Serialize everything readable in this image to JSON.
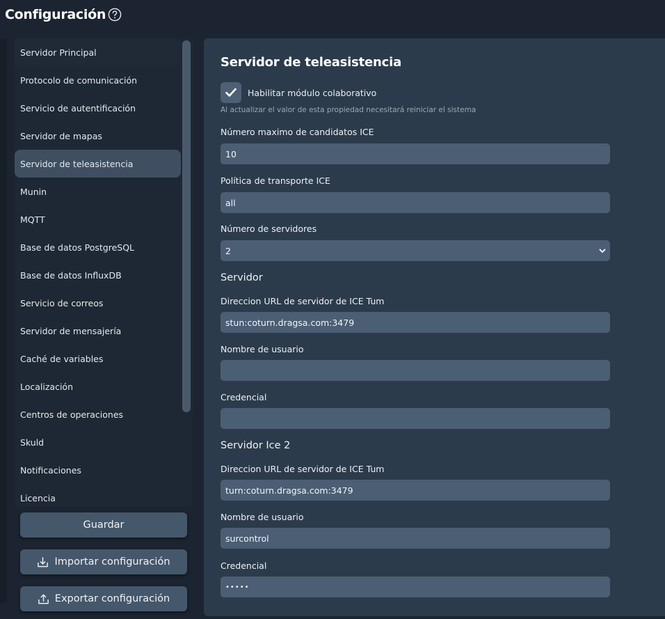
{
  "header": {
    "title": "Configuración"
  },
  "sidebar": {
    "items": [
      {
        "label": "Servidor Principal"
      },
      {
        "label": "Protocolo de comunicación"
      },
      {
        "label": "Servicio de autentificación"
      },
      {
        "label": "Servidor de mapas"
      },
      {
        "label": "Servidor de teleasistencia"
      },
      {
        "label": "Munin"
      },
      {
        "label": "MQTT"
      },
      {
        "label": "Base de datos PostgreSQL"
      },
      {
        "label": "Base de datos InfluxDB"
      },
      {
        "label": "Servicio de correos"
      },
      {
        "label": "Servidor de mensajería"
      },
      {
        "label": "Caché de variables"
      },
      {
        "label": "Localización"
      },
      {
        "label": "Centros de operaciones"
      },
      {
        "label": "Skuld"
      },
      {
        "label": "Notificaciones"
      },
      {
        "label": "Licencia"
      }
    ],
    "active": "Servidor de teleasistencia"
  },
  "actions": {
    "save_label": "Guardar",
    "import_label": "Importar configuración",
    "export_label": "Exportar configuración"
  },
  "panel": {
    "title": "Servidor de teleasistencia",
    "collab": {
      "label": "Habilitar módulo colaborativo",
      "checked": true,
      "hint": "Al actualizar el valor de esta propiedad necesitará reiniciar el sistema"
    },
    "max_ice_candidates": {
      "label": "Número maximo de candidatos ICE",
      "value": "10"
    },
    "ice_transport_policy": {
      "label": "Política de transporte ICE",
      "value": "all"
    },
    "server_count": {
      "label": "Número de servidores",
      "value": "2"
    },
    "servers": [
      {
        "heading": "Servidor",
        "url_label": "Direccion URL de servidor de ICE Tum",
        "url": "stun:coturn.dragsa.com:3479",
        "user_label": "Nombre de usuario",
        "user": "",
        "credential_label": "Credencial",
        "credential": ""
      },
      {
        "heading": "Servidor Ice 2",
        "url_label": "Direccion URL de servidor de ICE Tum",
        "url": "turn:coturn.dragsa.com:3479",
        "user_label": "Nombre de usuario",
        "user": "surcontrol",
        "credential_label": "Credencial",
        "credential": "•••••"
      }
    ]
  },
  "colors": {
    "background": "#1b2430",
    "sidebar": "#1e2834",
    "active_item": "#3f4f61",
    "panel": "#2c3b4b",
    "input": "#4b5e73",
    "button": "#45576b"
  }
}
